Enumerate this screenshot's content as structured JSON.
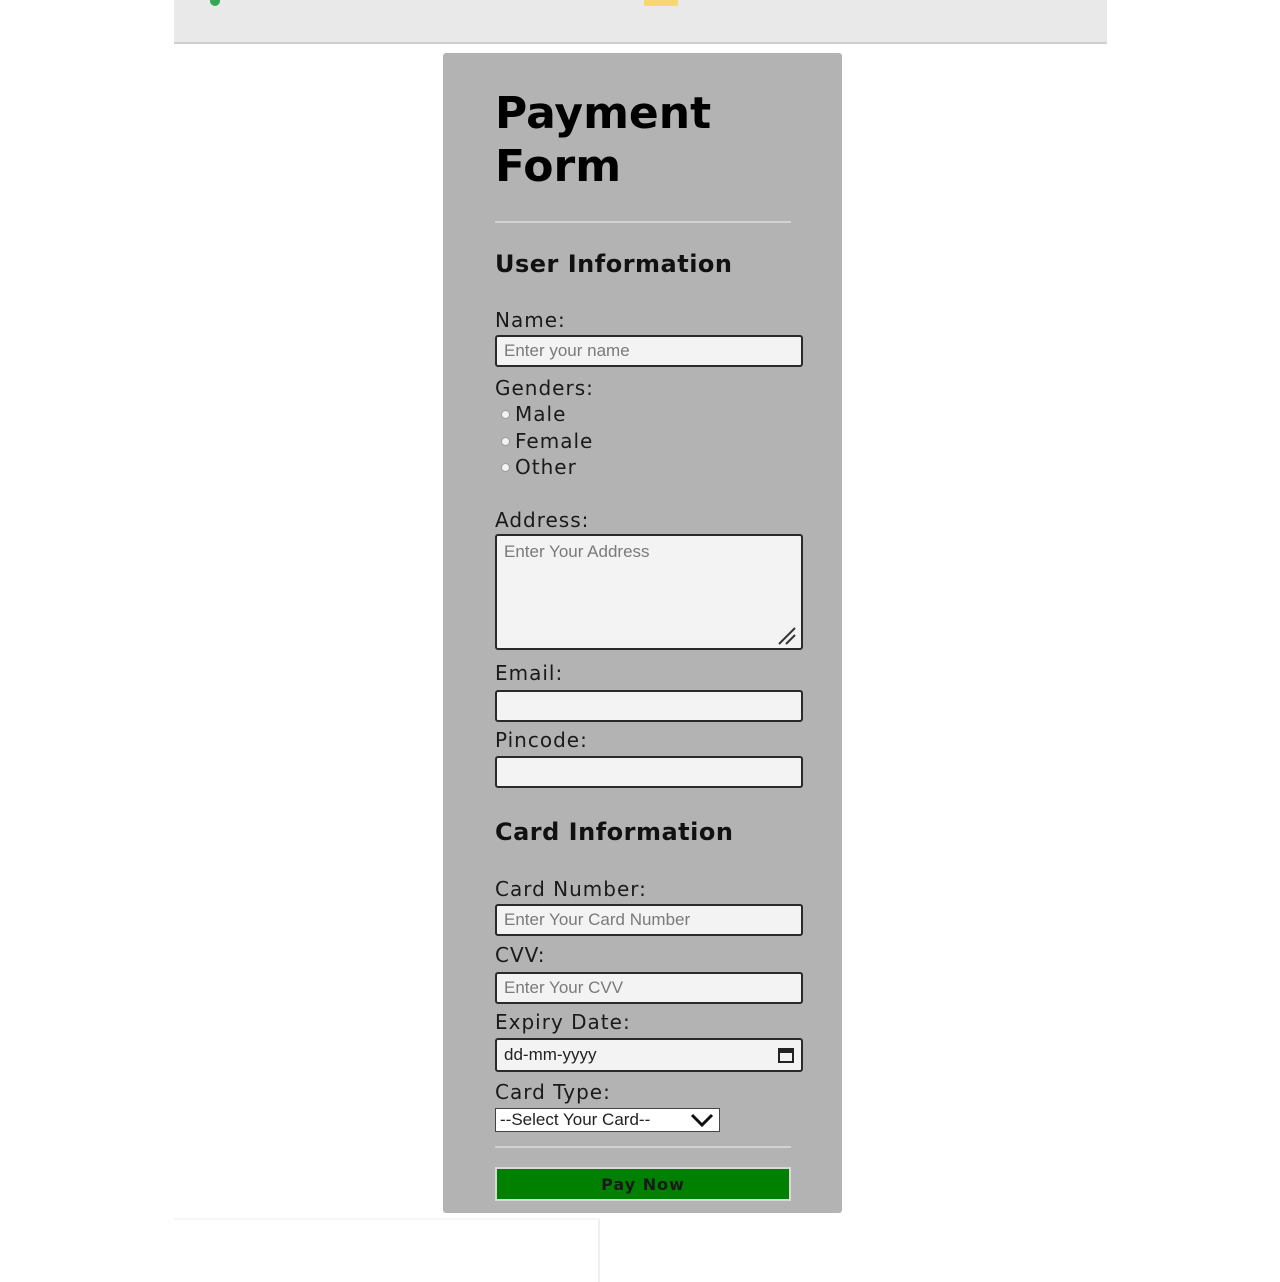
{
  "browser": {
    "icons": [
      "tab-favicon-icon",
      "folder-icon"
    ]
  },
  "form": {
    "title": "Payment Form",
    "user_section": {
      "heading": "User Information",
      "name_label": "Name:",
      "name_placeholder": "Enter your name",
      "genders_label": "Genders:",
      "gender_options": [
        "Male",
        "Female",
        "Other"
      ],
      "address_label": "Address:",
      "address_placeholder": "Enter Your Address",
      "email_label": "Email:",
      "email_value": "",
      "pincode_label": "Pincode:",
      "pincode_value": ""
    },
    "card_section": {
      "heading": "Card Information",
      "card_number_label": "Card Number:",
      "card_number_placeholder": "Enter Your Card Number",
      "cvv_label": "CVV:",
      "cvv_placeholder": "Enter Your CVV",
      "expiry_label": "Expiry Date:",
      "expiry_placeholder": "dd-mm-yyyy",
      "card_type_label": "Card Type:",
      "card_type_selected": "--Select Your Card--"
    },
    "submit_label": "Pay Now"
  },
  "colors": {
    "form_background": "#b3b3b3",
    "button_background": "#008000",
    "input_background": "#f3f3f3"
  }
}
